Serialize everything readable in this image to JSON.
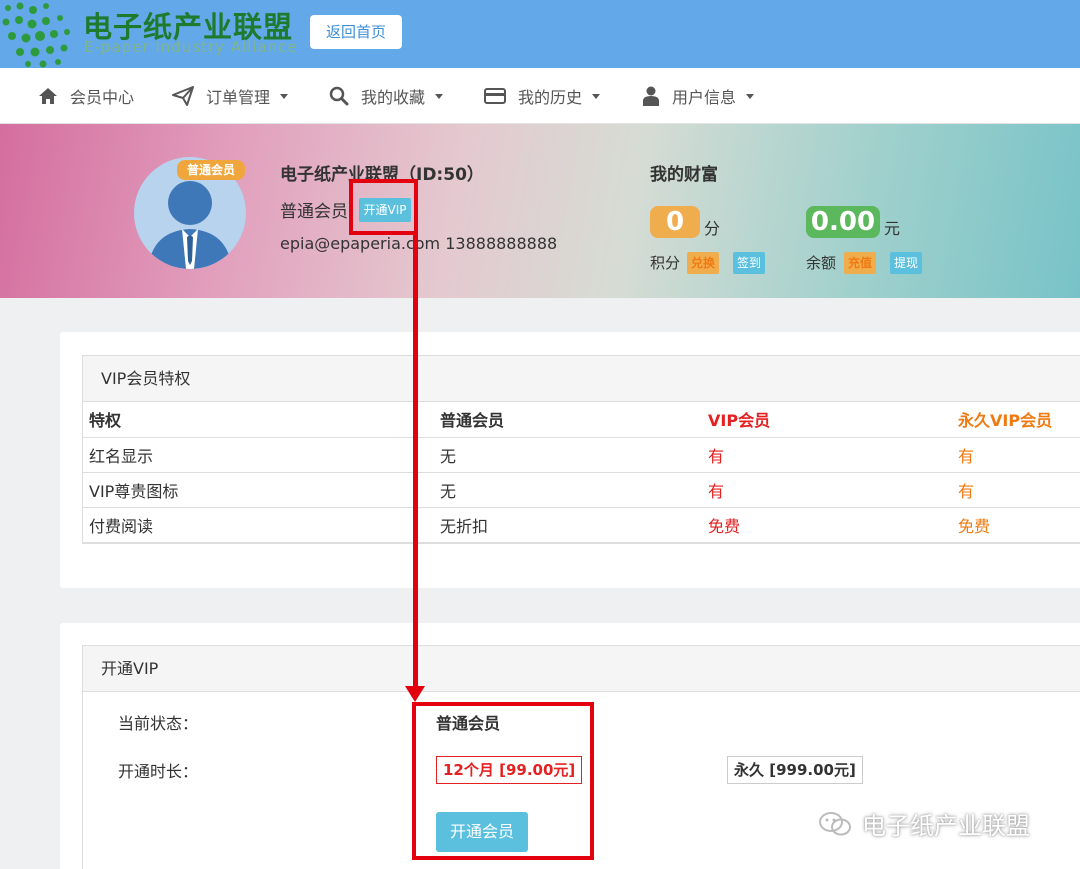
{
  "header": {
    "logo_cn": "电子纸产业联盟",
    "logo_en": "E-paper Industry Alliance",
    "home_button": "返回首页"
  },
  "nav": {
    "items": [
      {
        "label": "会员中心",
        "icon": "home-icon",
        "dropdown": false
      },
      {
        "label": "订单管理",
        "icon": "send-icon",
        "dropdown": true
      },
      {
        "label": "我的收藏",
        "icon": "search-icon",
        "dropdown": true
      },
      {
        "label": "我的历史",
        "icon": "card-icon",
        "dropdown": true
      },
      {
        "label": "用户信息",
        "icon": "user-icon",
        "dropdown": true
      }
    ]
  },
  "profile": {
    "badge": "普通会员",
    "name": "电子纸产业联盟（ID:50）",
    "level": "普通会员",
    "vip_button": "开通VIP",
    "contact": "epia@epaperia.com 13888888888"
  },
  "wealth": {
    "title": "我的财富",
    "points_value": "0",
    "points_unit": "分",
    "points_label": "积分",
    "exchange": "兑换",
    "checkin": "签到",
    "balance_value": "0.00",
    "balance_unit": "元",
    "balance_label": "余额",
    "recharge": "充值",
    "withdraw": "提现"
  },
  "privileges": {
    "title": "VIP会员特权",
    "headers": [
      "特权",
      "普通会员",
      "VIP会员",
      "永久VIP会员"
    ],
    "rows": [
      [
        "红名显示",
        "无",
        "有",
        "有"
      ],
      [
        "VIP尊贵图标",
        "无",
        "有",
        "有"
      ],
      [
        "付费阅读",
        "无折扣",
        "免费",
        "免费"
      ]
    ]
  },
  "open_vip": {
    "title": "开通VIP",
    "status_label": "当前状态：",
    "status_value": "普通会员",
    "duration_label": "开通时长：",
    "option_12m": "12个月 [99.00元]",
    "option_forever": "永久 [999.00元]",
    "submit": "开通会员"
  },
  "watermark": "电子纸产业联盟",
  "colors": {
    "header_blue": "#63a8e8",
    "vip_red": "#e52020",
    "forever_orange": "#f07a12",
    "annotation_red": "#e3000f",
    "info_blue": "#5bc0de"
  }
}
